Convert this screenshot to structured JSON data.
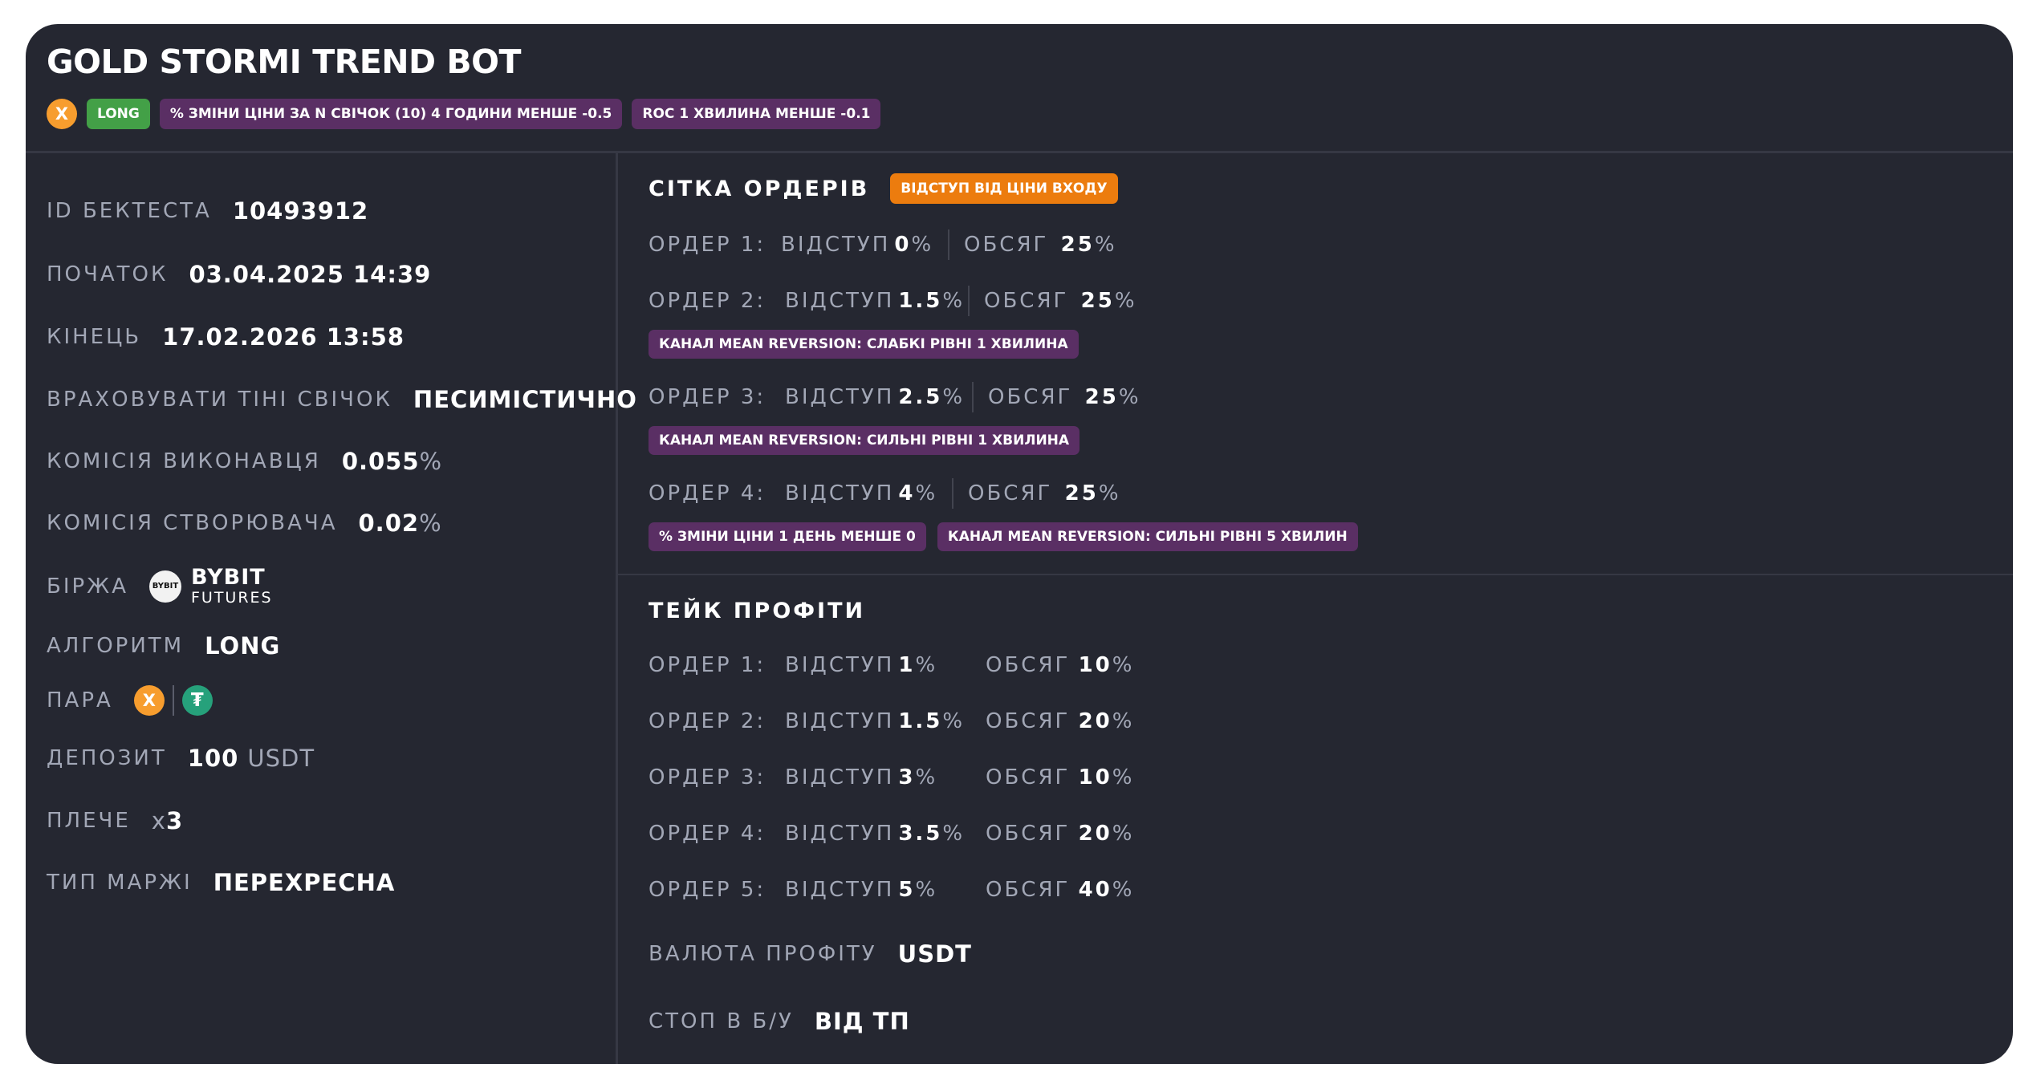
{
  "bot": {
    "title": "GOLD STORMI TREND BOT",
    "coin_icon": "X",
    "tags": [
      "LONG",
      "% ЗМІНИ ЦІНИ ЗА N СВІЧОК (10) 4 ГОДИНИ МЕНШЕ -0.5",
      "ROC 1 ХВИЛИНА МЕНШЕ -0.1"
    ]
  },
  "details": {
    "backtest_id": {
      "label": "ID БЕКТЕСТА",
      "value": "10493912"
    },
    "start": {
      "label": "ПОЧАТОК",
      "value": "03.04.2025 14:39"
    },
    "end": {
      "label": "КІНЕЦЬ",
      "value": "17.02.2026 13:58"
    },
    "shadows": {
      "label": "ВРАХОВУВАТИ ТІНІ СВІЧОК",
      "value": "ПЕСИМІСТИЧНО"
    },
    "taker_fee": {
      "label": "КОМІСІЯ ВИКОНАВЦЯ",
      "value": "0.055",
      "unit": "%"
    },
    "maker_fee": {
      "label": "КОМІСІЯ СТВОРЮВАЧА",
      "value": "0.02",
      "unit": "%"
    },
    "exchange": {
      "label": "БІРЖА",
      "logo_text": "BYBIT",
      "name": "BYBIT",
      "sub": "FUTURES"
    },
    "algorithm": {
      "label": "АЛГОРИТМ",
      "value": "LONG"
    },
    "pair": {
      "label": "ПАРА",
      "base_icon": "X",
      "quote_icon": "₮"
    },
    "deposit": {
      "label": "ДЕПОЗИТ",
      "value": "100",
      "unit": "USDT"
    },
    "leverage": {
      "label": "ПЛЕЧЕ",
      "prefix": "x",
      "value": "3"
    },
    "margin_type": {
      "label": "ТИП МАРЖІ",
      "value": "ПЕРЕХРЕСНА"
    }
  },
  "grid": {
    "title": "СІТКА ОРДЕРІВ",
    "badge": "ВІДСТУП ВІД ЦІНИ ВХОДУ",
    "offset_label": "ВІДСТУП",
    "volume_label": "ОБСЯГ",
    "orders": [
      {
        "label": "ОРДЕР 1:",
        "offset": "0",
        "volume": "25",
        "tags": []
      },
      {
        "label": "ОРДЕР 2:",
        "offset": "1.5",
        "volume": "25",
        "tags": [
          "КАНАЛ MEAN REVERSION: СЛАБКІ РІВНІ 1 ХВИЛИНА"
        ]
      },
      {
        "label": "ОРДЕР 3:",
        "offset": "2.5",
        "volume": "25",
        "tags": [
          "КАНАЛ MEAN REVERSION: СИЛЬНІ РІВНІ 1 ХВИЛИНА"
        ]
      },
      {
        "label": "ОРДЕР 4:",
        "offset": "4",
        "volume": "25",
        "tags": [
          "% ЗМІНИ ЦІНИ 1 ДЕНЬ МЕНШЕ 0",
          "КАНАЛ MEAN REVERSION: СИЛЬНІ РІВНІ 5 ХВИЛИН"
        ]
      }
    ]
  },
  "take_profit": {
    "title": "ТЕЙК ПРОФІТИ",
    "offset_label": "ВІДСТУП",
    "volume_label": "ОБСЯГ",
    "orders": [
      {
        "label": "ОРДЕР 1:",
        "offset": "1",
        "volume": "10"
      },
      {
        "label": "ОРДЕР 2:",
        "offset": "1.5",
        "volume": "20"
      },
      {
        "label": "ОРДЕР 3:",
        "offset": "3",
        "volume": "10"
      },
      {
        "label": "ОРДЕР 4:",
        "offset": "3.5",
        "volume": "20"
      },
      {
        "label": "ОРДЕР 5:",
        "offset": "5",
        "volume": "40"
      }
    ],
    "currency": {
      "label": "ВАЛЮТА ПРОФІТУ",
      "value": "USDT"
    },
    "breakeven": {
      "label": "СТОП В Б/У",
      "value": "ВІД ТП"
    }
  },
  "pct_sign": "%",
  "colors": {
    "card": "#252731",
    "label": "#a2a7b6",
    "green": "#43a047",
    "purple": "#5a2f64",
    "orange": "#ec7c0e",
    "xcoin": "#f79d2e",
    "usdt": "#26a17b"
  }
}
